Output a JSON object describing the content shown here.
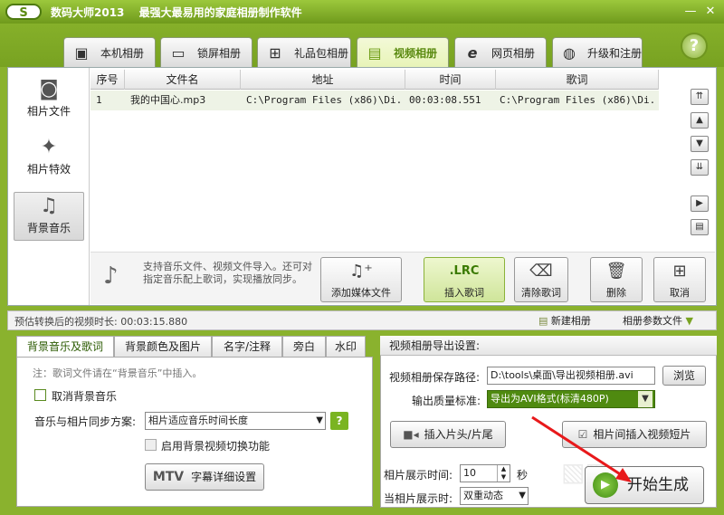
{
  "window": {
    "logo": "S",
    "title": "数码大师2013　 最强大最易用的家庭相册制作软件",
    "minimize": "—",
    "close": "✕"
  },
  "tabs": [
    {
      "label": "本机相册",
      "icon": "album-icon"
    },
    {
      "label": "锁屏相册",
      "icon": "monitor-icon"
    },
    {
      "label": "礼品包相册",
      "icon": "gift-icon"
    },
    {
      "label": "视频相册",
      "icon": "film-icon",
      "active": true
    },
    {
      "label": "网页相册",
      "icon": "ie-icon"
    },
    {
      "label": "升级和注册",
      "icon": "globe-icon"
    }
  ],
  "help": "?",
  "nav": [
    {
      "label": "相片文件",
      "icon": "camera-icon"
    },
    {
      "label": "相片特效",
      "icon": "effects-icon"
    },
    {
      "label": "背景音乐",
      "icon": "music-icon",
      "selected": true
    }
  ],
  "table": {
    "headers": [
      "序号",
      "文件名",
      "地址",
      "时间",
      "歌词"
    ],
    "rows": [
      [
        "1",
        "我的中国心.mp3",
        "C:\\Program Files (x86)\\Di...",
        "00:03:08.551",
        "C:\\Program Files (x86)\\Di..."
      ]
    ]
  },
  "info": {
    "text": "支持音乐文件、视频文件导入。还可对指定音乐配上歌词，实现播放同步。"
  },
  "actions": {
    "add_media": "添加媒体文件",
    "insert_lyrics": "插入歌词",
    "lrc": ".LRC",
    "clear_lyrics": "清除歌词",
    "delete": "删除",
    "cancel": "取消"
  },
  "status": {
    "estimate": "预估转换后的视频时长: 00:03:15.880",
    "new_album": "新建相册",
    "album_params": "相册参数文件"
  },
  "lower_tabs": [
    "背景音乐及歌词",
    "背景颜色及图片",
    "名字/注释",
    "旁白",
    "水印"
  ],
  "music_panel": {
    "note": "注：歌词文件请在“背景音乐”中插入。",
    "cancel_bg_music": "取消背景音乐",
    "sync_label": "音乐与相片同步方案:",
    "sync_value": "相片适应音乐时间长度",
    "enable_video_switch": "启用背景视频切换功能",
    "mtv_label": "MTV",
    "mtv_settings": "字幕详细设置"
  },
  "export": {
    "header": "视频相册导出设置:",
    "save_path_label": "视频相册保存路径:",
    "save_path_value": "D:\\tools\\桌面\\导出视频相册.avi",
    "browse": "浏览",
    "quality_label": "输出质量标准:",
    "quality_value": "导出为AVI格式(标清480P)",
    "insert_head_tail": "插入片头/片尾",
    "insert_clip": "相片间插入视频短片",
    "display_time_label": "相片展示时间:",
    "display_time_value": "10",
    "display_time_unit": "秒",
    "when_display_label": "当相片展示时:",
    "when_display_value": "双重动态",
    "start": "开始生成"
  },
  "colors": {
    "brand_green": "#7aa423",
    "accent_red": "#e8191b"
  }
}
